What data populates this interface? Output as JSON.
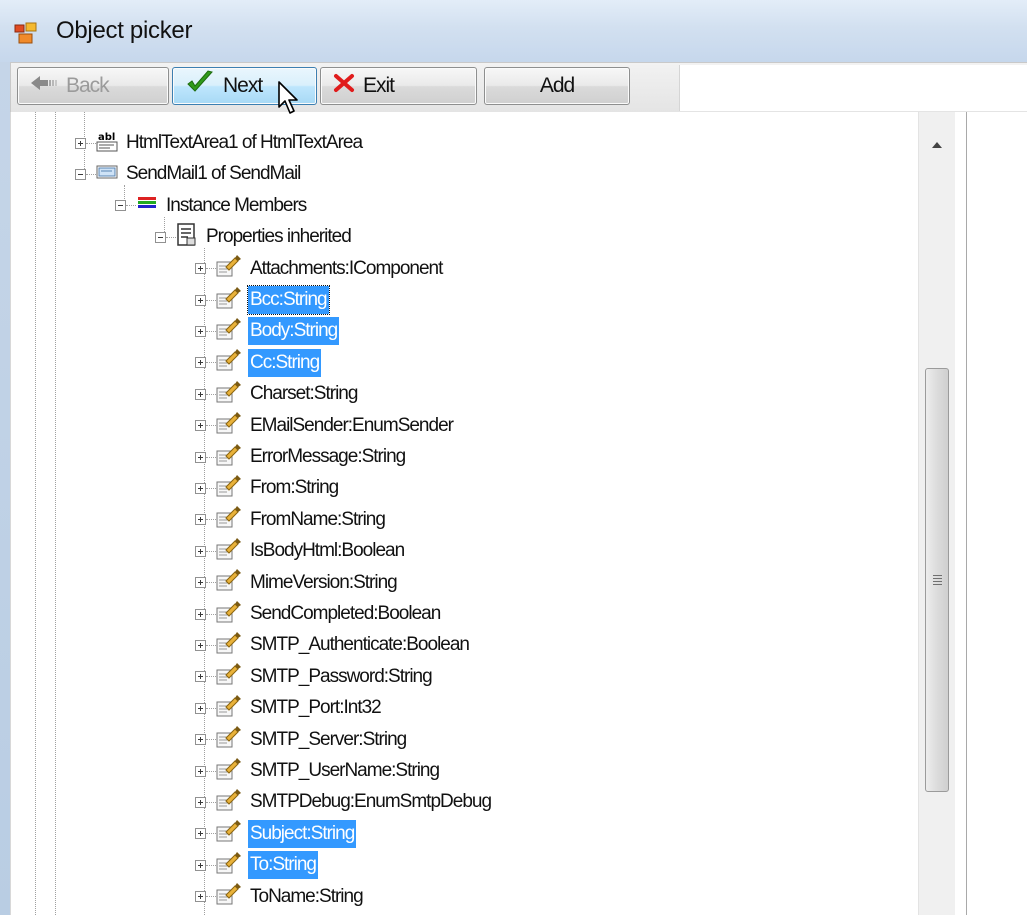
{
  "window": {
    "title": "Object picker",
    "icon": "object-picker-app-icon"
  },
  "toolbar": {
    "back_label": "Back",
    "next_label": "Next",
    "exit_label": "Exit",
    "add_label": "Add"
  },
  "tree": {
    "nodes": [
      {
        "label": "HtmlTextArea1 of HtmlTextArea",
        "icon": "textarea-icon",
        "level": 0,
        "expander": "plus",
        "selected": false
      },
      {
        "label": "SendMail1 of SendMail",
        "icon": "sendmail-icon",
        "level": 0,
        "expander": "minus",
        "selected": false
      },
      {
        "label": "Instance Members",
        "icon": "instance-members-icon",
        "level": 1,
        "expander": "minus",
        "selected": false
      },
      {
        "label": "Properties inherited",
        "icon": "properties-inherited-icon",
        "level": 2,
        "expander": "minus",
        "selected": false
      },
      {
        "label": "Attachments:IComponent",
        "icon": "property-icon",
        "level": 3,
        "expander": "plus",
        "selected": false
      },
      {
        "label": "Bcc:String",
        "icon": "property-icon",
        "level": 3,
        "expander": "plus",
        "selected": true
      },
      {
        "label": "Body:String",
        "icon": "property-icon",
        "level": 3,
        "expander": "plus",
        "selected": true
      },
      {
        "label": "Cc:String",
        "icon": "property-icon",
        "level": 3,
        "expander": "plus",
        "selected": true
      },
      {
        "label": "Charset:String",
        "icon": "property-icon",
        "level": 3,
        "expander": "plus",
        "selected": false
      },
      {
        "label": "EMailSender:EnumSender",
        "icon": "property-icon",
        "level": 3,
        "expander": "plus",
        "selected": false
      },
      {
        "label": "ErrorMessage:String",
        "icon": "property-icon",
        "level": 3,
        "expander": "plus",
        "selected": false
      },
      {
        "label": "From:String",
        "icon": "property-icon",
        "level": 3,
        "expander": "plus",
        "selected": false
      },
      {
        "label": "FromName:String",
        "icon": "property-icon",
        "level": 3,
        "expander": "plus",
        "selected": false
      },
      {
        "label": "IsBodyHtml:Boolean",
        "icon": "property-icon",
        "level": 3,
        "expander": "plus",
        "selected": false
      },
      {
        "label": "MimeVersion:String",
        "icon": "property-icon",
        "level": 3,
        "expander": "plus",
        "selected": false
      },
      {
        "label": "SendCompleted:Boolean",
        "icon": "property-icon",
        "level": 3,
        "expander": "plus",
        "selected": false
      },
      {
        "label": "SMTP_Authenticate:Boolean",
        "icon": "property-icon",
        "level": 3,
        "expander": "plus",
        "selected": false
      },
      {
        "label": "SMTP_Password:String",
        "icon": "property-icon",
        "level": 3,
        "expander": "plus",
        "selected": false
      },
      {
        "label": "SMTP_Port:Int32",
        "icon": "property-icon",
        "level": 3,
        "expander": "plus",
        "selected": false
      },
      {
        "label": "SMTP_Server:String",
        "icon": "property-icon",
        "level": 3,
        "expander": "plus",
        "selected": false
      },
      {
        "label": "SMTP_UserName:String",
        "icon": "property-icon",
        "level": 3,
        "expander": "plus",
        "selected": false
      },
      {
        "label": "SMTPDebug:EnumSmtpDebug",
        "icon": "property-icon",
        "level": 3,
        "expander": "plus",
        "selected": false
      },
      {
        "label": "Subject:String",
        "icon": "property-icon",
        "level": 3,
        "expander": "plus",
        "selected": true
      },
      {
        "label": "To:String",
        "icon": "property-icon",
        "level": 3,
        "expander": "plus",
        "selected": true
      },
      {
        "label": "ToName:String",
        "icon": "property-icon",
        "level": 3,
        "expander": "plus",
        "selected": false
      }
    ]
  },
  "colors": {
    "selection": "#3399ff",
    "selection_text": "#ffffff"
  }
}
